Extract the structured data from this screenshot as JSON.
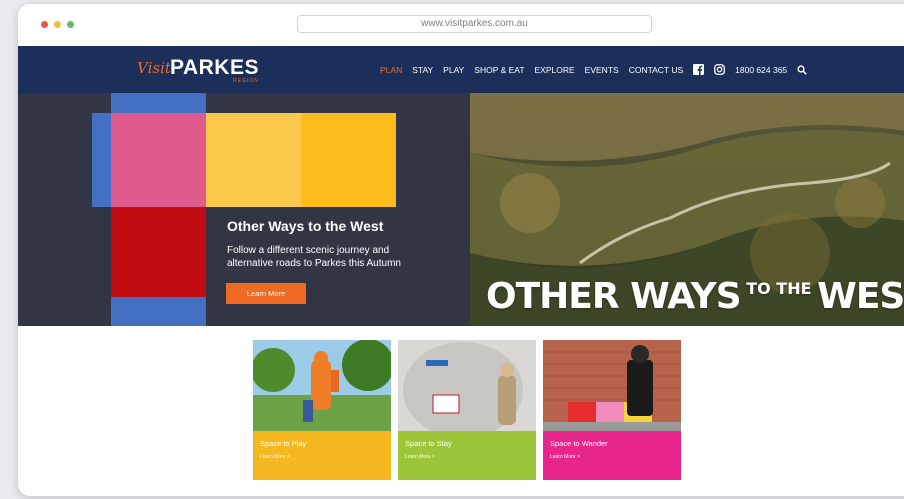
{
  "browser": {
    "url": "www.visitparkes.com.au"
  },
  "logo": {
    "visit": "Visit",
    "parkes": "PARKES",
    "region": "REGION"
  },
  "nav": {
    "items": [
      "PLAN",
      "STAY",
      "PLAY",
      "SHOP & EAT",
      "EXPLORE",
      "EVENTS",
      "CONTACT US"
    ],
    "active": "PLAN",
    "phone": "1800 624 365",
    "icons": [
      "facebook-icon",
      "instagram-icon",
      "search-icon"
    ]
  },
  "hero": {
    "title": "Other Ways to the West",
    "subtitle": "Follow a different scenic journey and alternative roads to Parkes this Autumn",
    "button": "Learn More",
    "overlay_big_1": "OTHER WAYS",
    "overlay_small": "TO THE",
    "overlay_big_2": "WEST"
  },
  "cards": [
    {
      "title": "Space to Play",
      "link": "Learn More >",
      "color": "#f6b820"
    },
    {
      "title": "Space to Stay",
      "link": "Learn More >",
      "color": "#9dc53a"
    },
    {
      "title": "Space to Wander",
      "link": "Learn More >",
      "color": "#e8258b"
    }
  ],
  "colors": {
    "navy": "#1c2f5a",
    "orange": "#ef6a22",
    "hero_dark": "#323543",
    "blue": "#4470c4",
    "pink": "#df5a8d",
    "yellow": "#fdc94a",
    "red": "#c10c12"
  }
}
